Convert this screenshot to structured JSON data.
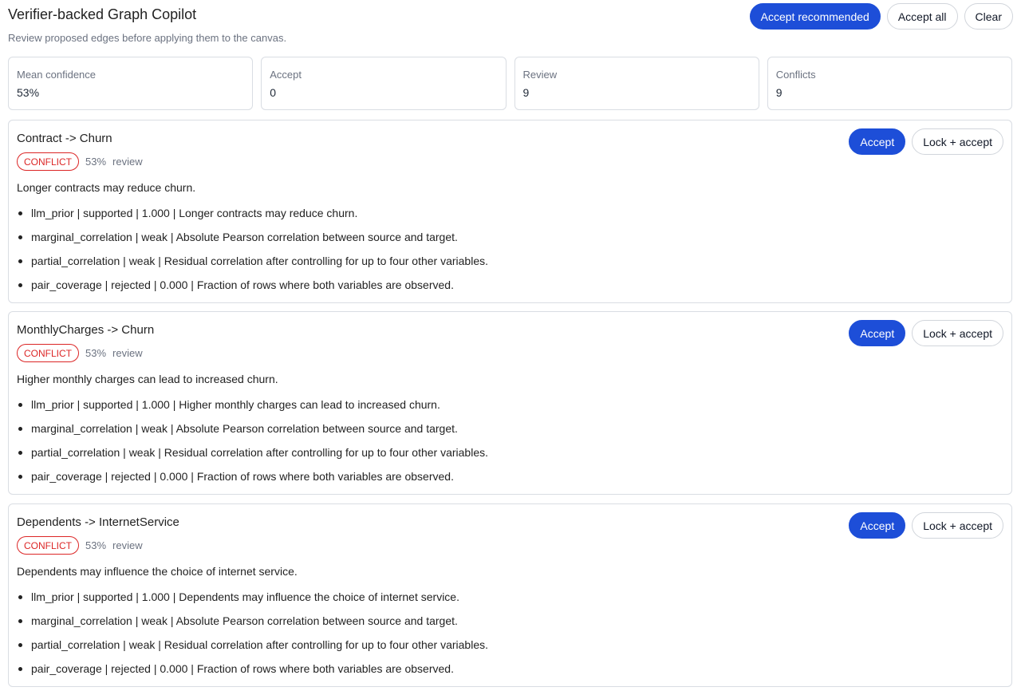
{
  "header": {
    "title": "Verifier-backed Graph Copilot",
    "subtitle": "Review proposed edges before applying them to the canvas.",
    "actions": {
      "accept_recommended": "Accept recommended",
      "accept_all": "Accept all",
      "clear": "Clear"
    }
  },
  "stats": [
    {
      "label": "Mean confidence",
      "value": "53%"
    },
    {
      "label": "Accept",
      "value": "0"
    },
    {
      "label": "Review",
      "value": "9"
    },
    {
      "label": "Conflicts",
      "value": "9"
    }
  ],
  "cards": [
    {
      "title": "Contract -> Churn",
      "badge": "CONFLICT",
      "confidence": "53%",
      "status": "review",
      "description": "Longer contracts may reduce churn.",
      "accept_label": "Accept",
      "lock_accept_label": "Lock + accept",
      "evidence": [
        "llm_prior | supported | 1.000 | Longer contracts may reduce churn.",
        "marginal_correlation | weak | Absolute Pearson correlation between source and target.",
        "partial_correlation | weak | Residual correlation after controlling for up to four other variables.",
        "pair_coverage | rejected | 0.000 | Fraction of rows where both variables are observed."
      ]
    },
    {
      "title": "MonthlyCharges -> Churn",
      "badge": "CONFLICT",
      "confidence": "53%",
      "status": "review",
      "description": "Higher monthly charges can lead to increased churn.",
      "accept_label": "Accept",
      "lock_accept_label": "Lock + accept",
      "evidence": [
        "llm_prior | supported | 1.000 | Higher monthly charges can lead to increased churn.",
        "marginal_correlation | weak | Absolute Pearson correlation between source and target.",
        "partial_correlation | weak | Residual correlation after controlling for up to four other variables.",
        "pair_coverage | rejected | 0.000 | Fraction of rows where both variables are observed."
      ]
    },
    {
      "title": "Dependents -> InternetService",
      "badge": "CONFLICT",
      "confidence": "53%",
      "status": "review",
      "description": "Dependents may influence the choice of internet service.",
      "accept_label": "Accept",
      "lock_accept_label": "Lock + accept",
      "evidence": [
        "llm_prior | supported | 1.000 | Dependents may influence the choice of internet service.",
        "marginal_correlation | weak | Absolute Pearson correlation between source and target.",
        "partial_correlation | weak | Residual correlation after controlling for up to four other variables.",
        "pair_coverage | rejected | 0.000 | Fraction of rows where both variables are observed."
      ]
    }
  ],
  "colors": {
    "primary": "#1d4ed8",
    "conflict": "#dc2626",
    "border": "#d9dde3",
    "muted_text": "#6b7280"
  }
}
